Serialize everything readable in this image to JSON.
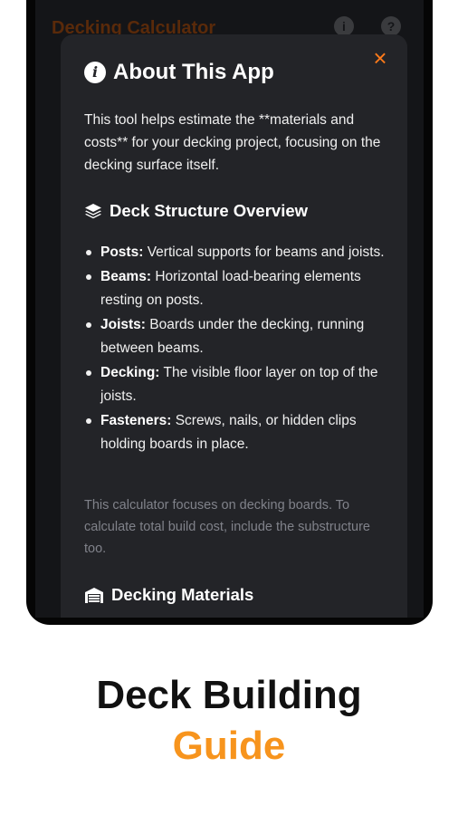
{
  "app": {
    "title": "Decking Calculator"
  },
  "modal": {
    "close_symbol": "×",
    "title": "About This App",
    "intro": "This tool helps estimate the **materials and costs** for your decking project, focusing on the decking surface itself.",
    "structure_heading": "Deck Structure Overview",
    "parts": [
      {
        "term": "Posts:",
        "desc": "Vertical supports for beams and joists."
      },
      {
        "term": "Beams:",
        "desc": "Horizontal load-bearing elements resting on posts."
      },
      {
        "term": "Joists:",
        "desc": "Boards under the decking, running between beams."
      },
      {
        "term": "Decking:",
        "desc": "The visible floor layer on top of the joists."
      },
      {
        "term": "Fasteners:",
        "desc": "Screws, nails, or hidden clips holding boards in place."
      }
    ],
    "note": "This calculator focuses on decking boards. To calculate total build cost, include the substructure too.",
    "materials_heading": "Decking Materials"
  },
  "caption": {
    "line1": "Deck Building",
    "line2": "Guide"
  },
  "colors": {
    "accent": "#f7941d",
    "close": "#ff7a1a",
    "modal_bg": "#232428"
  },
  "icons": {
    "info": "info-icon",
    "close": "close-icon",
    "layers": "layers-icon",
    "warehouse": "warehouse-icon"
  }
}
